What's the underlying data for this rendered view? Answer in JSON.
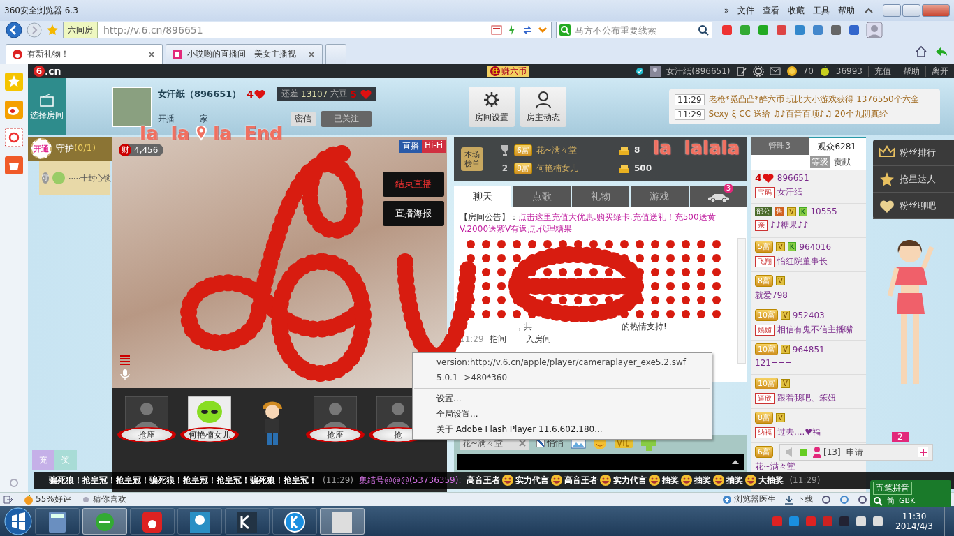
{
  "browser": {
    "title": "360安全浏览器 6.3",
    "menu": [
      "»",
      "文件",
      "查看",
      "收藏",
      "工具",
      "帮助"
    ],
    "site_badge": "六间房",
    "url": "http://v.6.cn/896651",
    "search": {
      "placeholder": "马方不公布重要线索"
    },
    "tabs": [
      {
        "label": "有新礼物！",
        "kind": "six",
        "selected": true
      },
      {
        "label": "小哎哟的直播间 - 美女主播视",
        "kind": "le",
        "selected": false
      }
    ]
  },
  "topbar": {
    "logo_mark": "6",
    "logo_text": ".cn",
    "earn_icon": "任",
    "earn": "赚六币",
    "user": "女汗纸(896651)",
    "coins": "70",
    "beans": "36993",
    "links": [
      "充值",
      "帮助",
      "离开"
    ]
  },
  "header": {
    "select_room": "选择房间",
    "host_name": "女汗纸（896651）",
    "host_level": "4",
    "tooltip": {
      "prefix": "还差",
      "amount": "13107",
      "unit": "六豆",
      "next_level": "5"
    },
    "info": [
      "开播",
      "家"
    ],
    "message_button": "密信",
    "follow_button": "已关注",
    "buttons": [
      {
        "label": "房间设置",
        "kind": "settings"
      },
      {
        "label": "房主动态",
        "kind": "person"
      }
    ],
    "notices": [
      {
        "time": "11:29",
        "text": "老枪*觅凸凸*醉六币 玩比大小游戏获得 1376550个六金"
      },
      {
        "time": "11:29",
        "text": "Sexy-ξ CC 送给 ♫♪百音百顺♪♫ 20个九阴真经"
      }
    ]
  },
  "overlay_caption": {
    "before_pin": "la  la",
    "after_pin": "la  End",
    "second": "la  lalala"
  },
  "guard": {
    "open": "开通",
    "title": "守护",
    "count": "(0/1)",
    "badge": "守",
    "member": "·····十封心锁"
  },
  "video": {
    "wealth_icon": "财",
    "wealth": "4,456",
    "tags": [
      "直播",
      "Hi-Fi"
    ],
    "actions": [
      "结束直播",
      "直播海报"
    ]
  },
  "seats": [
    {
      "kind": "empty",
      "label": "抢座"
    },
    {
      "kind": "alien",
      "label": "何艳楠女儿"
    },
    {
      "kind": "character"
    },
    {
      "kind": "empty",
      "label": "抢座"
    },
    {
      "kind": "empty",
      "label": "抢"
    }
  ],
  "reward_buttons": [
    "充",
    "奖"
  ],
  "ranking": {
    "title": "本场榜单",
    "rows": [
      {
        "kind": "trophy",
        "badge": "6富",
        "name": "花~满々堂",
        "amount": "8"
      },
      {
        "kind": "number",
        "rank": "2",
        "badge": "8富",
        "name": "何艳楠女儿",
        "amount": "500"
      }
    ]
  },
  "chat_tabs": [
    {
      "kind": "text",
      "label": "聊天",
      "selected": true
    },
    {
      "kind": "text",
      "label": "点歌",
      "selected": false
    },
    {
      "kind": "text",
      "label": "礼物",
      "selected": false
    },
    {
      "kind": "text",
      "label": "游戏",
      "selected": false
    },
    {
      "kind": "car",
      "badge": "3",
      "selected": false
    }
  ],
  "announcement": {
    "label": "【房间公告】：",
    "text": "点击这里充值大优惠.购买绿卡.充值送礼！充500送黄V.2000送紫V有返点.代理糖果"
  },
  "chat_fragments": {
    "thanks_a": "，共",
    "thanks_b": "的热情支持!",
    "time": "11:29",
    "enter_a": "指间",
    "enter_b": "入房间"
  },
  "chat_input": {
    "recipient": "花~满々堂",
    "whisper": {
      "label": "悄悄",
      "checked": true
    }
  },
  "audience": {
    "tabs": [
      {
        "label": "管理3",
        "selected": false
      },
      {
        "label": "观众6281",
        "selected": true
      }
    ],
    "sort": [
      {
        "label": "等级",
        "selected": true
      },
      {
        "label": "贡献",
        "selected": false
      }
    ],
    "users": [
      {
        "badges": [
          {
            "kind": "heart",
            "text": "4"
          }
        ],
        "id": "896651",
        "tag": "宝码",
        "name": "女汗纸"
      },
      {
        "badges": [
          {
            "kind": "rank",
            "text": "部公"
          },
          {
            "kind": "shop",
            "text": "售"
          },
          {
            "kind": "vip",
            "text": "V"
          },
          {
            "kind": "k",
            "text": "K"
          }
        ],
        "id": "10555",
        "tag": "亲",
        "name": "♪♪糖果♪♪"
      },
      {
        "badges": [
          {
            "kind": "rich",
            "text": "5富"
          },
          {
            "kind": "vip",
            "text": "V"
          },
          {
            "kind": "k",
            "text": "K"
          }
        ],
        "id": "964016",
        "tag": "飞翔",
        "name": "怡红院董事长"
      },
      {
        "badges": [
          {
            "kind": "rich",
            "text": "8富"
          },
          {
            "kind": "vip",
            "text": "V"
          }
        ],
        "name": "就爱798"
      },
      {
        "badges": [
          {
            "kind": "rich",
            "text": "10富"
          },
          {
            "kind": "vip",
            "text": "V"
          }
        ],
        "id": "952403",
        "tag": "嫣媚",
        "name": "相信有鬼不信主播嘴"
      },
      {
        "badges": [
          {
            "kind": "rich",
            "text": "10富"
          },
          {
            "kind": "vip",
            "text": "V"
          }
        ],
        "id": "964851",
        "name": "121==="
      },
      {
        "badges": [
          {
            "kind": "rich",
            "text": "10富"
          },
          {
            "kind": "vip",
            "text": "V"
          }
        ],
        "tag": "逼欣",
        "name": "跟着我吧、笨妞"
      },
      {
        "badges": [
          {
            "kind": "rich",
            "text": "8富"
          },
          {
            "kind": "vip",
            "text": "V"
          }
        ],
        "tag": "纳福",
        "name": "过去....♥福"
      },
      {
        "badges": [
          {
            "kind": "rich",
            "text": "6富"
          }
        ],
        "name": "花~满々堂"
      }
    ]
  },
  "fan_buttons": [
    {
      "kind": "crown",
      "label": "粉丝排行"
    },
    {
      "kind": "star",
      "label": "抢星达人"
    },
    {
      "kind": "heart",
      "label": "粉丝聊吧"
    }
  ],
  "mic_bar": {
    "count": "[13]",
    "apply": "申请",
    "badge": "2"
  },
  "marquee": [
    {
      "kind": "bold",
      "text": "骗死狼！抢皇冠！抢皇冠！骗死狼！抢皇冠！抢皇冠！骗死狼！抢皇冠！"
    },
    {
      "kind": "time",
      "text": "(11:29)"
    },
    {
      "kind": "sender",
      "text": "集结号@@@(53736359):"
    },
    {
      "kind": "bold",
      "text": "高音王者"
    },
    {
      "kind": "emoji"
    },
    {
      "kind": "bold",
      "text": "实力代言"
    },
    {
      "kind": "emoji"
    },
    {
      "kind": "bold",
      "text": "高音王者"
    },
    {
      "kind": "emoji"
    },
    {
      "kind": "bold",
      "text": "实力代言"
    },
    {
      "kind": "emoji"
    },
    {
      "kind": "bold",
      "text": "抽奖"
    },
    {
      "kind": "emoji"
    },
    {
      "kind": "bold",
      "text": "抽奖"
    },
    {
      "kind": "emoji"
    },
    {
      "kind": "bold",
      "text": "抽奖"
    },
    {
      "kind": "emoji"
    },
    {
      "kind": "bold",
      "text": "大抽奖"
    },
    {
      "kind": "time",
      "text": "(11:29)"
    }
  ],
  "context_menu": [
    {
      "kind": "info",
      "text": "version:http://v.6.cn/apple/player/cameraplayer_exe5.2.swf"
    },
    {
      "kind": "info",
      "text": "5.0.1-->480*360"
    },
    {
      "kind": "action",
      "text": "设置..."
    },
    {
      "kind": "action",
      "text": "全局设置..."
    },
    {
      "kind": "action",
      "text": "关于 Adobe Flash Player 11.6.602.180..."
    }
  ],
  "status_bar": {
    "left": [
      {
        "kind": "rating",
        "text": "55%好评"
      },
      {
        "kind": "dot",
        "text": "猜你喜欢"
      }
    ],
    "right": [
      "浏览器医生",
      "下载"
    ]
  },
  "ime": {
    "mode": "五笔拼音",
    "script": "简",
    "charset": "GBK"
  },
  "taskbar": {
    "apps": [
      {
        "kind": "calc",
        "selected": false
      },
      {
        "kind": "browser",
        "selected": true
      },
      {
        "kind": "six",
        "selected": false
      },
      {
        "kind": "fish",
        "selected": false
      },
      {
        "kind": "kx",
        "selected": false
      },
      {
        "kind": "k",
        "selected": false
      },
      {
        "kind": "photo",
        "selected": true
      }
    ],
    "time": "11:30",
    "date": "2014/4/3"
  }
}
